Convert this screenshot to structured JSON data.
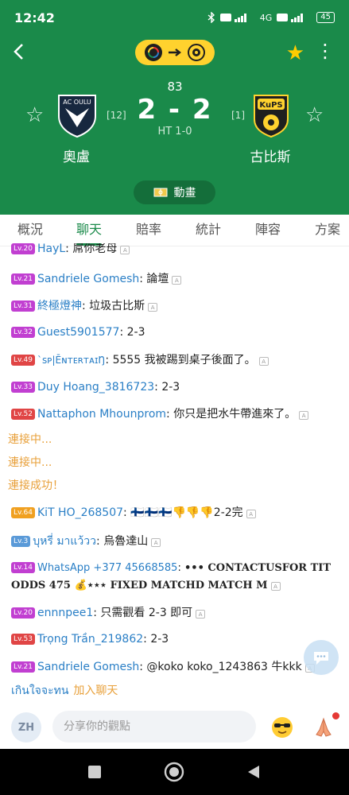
{
  "status": {
    "time": "12:42",
    "battery": "45",
    "net": "4G"
  },
  "match": {
    "minute": "83",
    "score": "2 - 2",
    "halftime": "HT 1-0",
    "home": {
      "name": "奧盧",
      "rank": "[12]",
      "logo_text": "AC OULU"
    },
    "away": {
      "name": "古比斯",
      "rank": "[1]",
      "logo_text": "KuPS"
    },
    "animation_label": "動畫"
  },
  "tabs": [
    "概況",
    "聊天",
    "賠率",
    "統計",
    "陣容",
    "方案"
  ],
  "active_tab": "聊天",
  "colors": {
    "header": "#1a8a4a",
    "accent": "#1a8a4a",
    "pill": "#ffd22e",
    "star": "#ffcc00",
    "system": "#e8a03a",
    "username": "#2a7fc6"
  },
  "chat": [
    {
      "level": "Lv.20",
      "lv_color": "#c13fd1",
      "user": "HayL",
      "text": "屌你老母"
    },
    {
      "level": "Lv.21",
      "lv_color": "#c13fd1",
      "user": "Sandriele Gomesh",
      "text": "論壇"
    },
    {
      "level": "Lv.31",
      "lv_color": "#c13fd1",
      "user": "終極燈神",
      "text": "垃圾古比斯"
    },
    {
      "level": "Lv.32",
      "lv_color": "#c13fd1",
      "user": "Guest5901577",
      "text": "2-3"
    },
    {
      "level": "Lv.49",
      "lv_color": "#e04545",
      "user": "`ꜱᴘ|ĒɴᴛᴇʀᴛᴀɪŊ",
      "text": "5555 我被踢到桌子後面了。"
    },
    {
      "level": "Lv.33",
      "lv_color": "#c13fd1",
      "user": "Duy Hoang_3816723",
      "text": "2-3"
    },
    {
      "level": "Lv.52",
      "lv_color": "#e04545",
      "user": "Nattaphon Mhounprom",
      "text": "你只是把水牛帶進來了。"
    },
    {
      "system": "連接中..."
    },
    {
      "system": "連接中..."
    },
    {
      "system": "連接成功！"
    },
    {
      "level": "Lv.64",
      "lv_color": "#f0a020",
      "user": "KiT HO_268507",
      "text": "🇫🇮🇫🇮🇫🇮👎👎👎2-2完"
    },
    {
      "level": "Lv.3",
      "lv_color": "#5a9ad8",
      "user": "บุหรี่ มาแว้วว",
      "text": "烏魯達山"
    },
    {
      "level": "Lv.14",
      "lv_color": "#c13fd1",
      "user": "WhatsApp +377 45668585",
      "text": "••• CONTACTUSFOR TIT ODDS 475 💰⋆⋆⋆ FIXED MATCHD MATCH M"
    },
    {
      "level": "Lv.20",
      "lv_color": "#c13fd1",
      "user": "ennnpee1",
      "text": "只需觀看 2-3 即可"
    },
    {
      "level": "Lv.53",
      "lv_color": "#e04545",
      "user": "Trọng Trần_219862",
      "text": "2-3"
    },
    {
      "level": "Lv.21",
      "lv_color": "#c13fd1",
      "user": "Sandriele Gomesh",
      "text": "@koko koko_1243863 牛kkk"
    }
  ],
  "join": {
    "user": "เกินใจจะทน",
    "label": "加入聊天"
  },
  "input": {
    "avatar": "ZH",
    "placeholder": "分享你的觀點"
  }
}
